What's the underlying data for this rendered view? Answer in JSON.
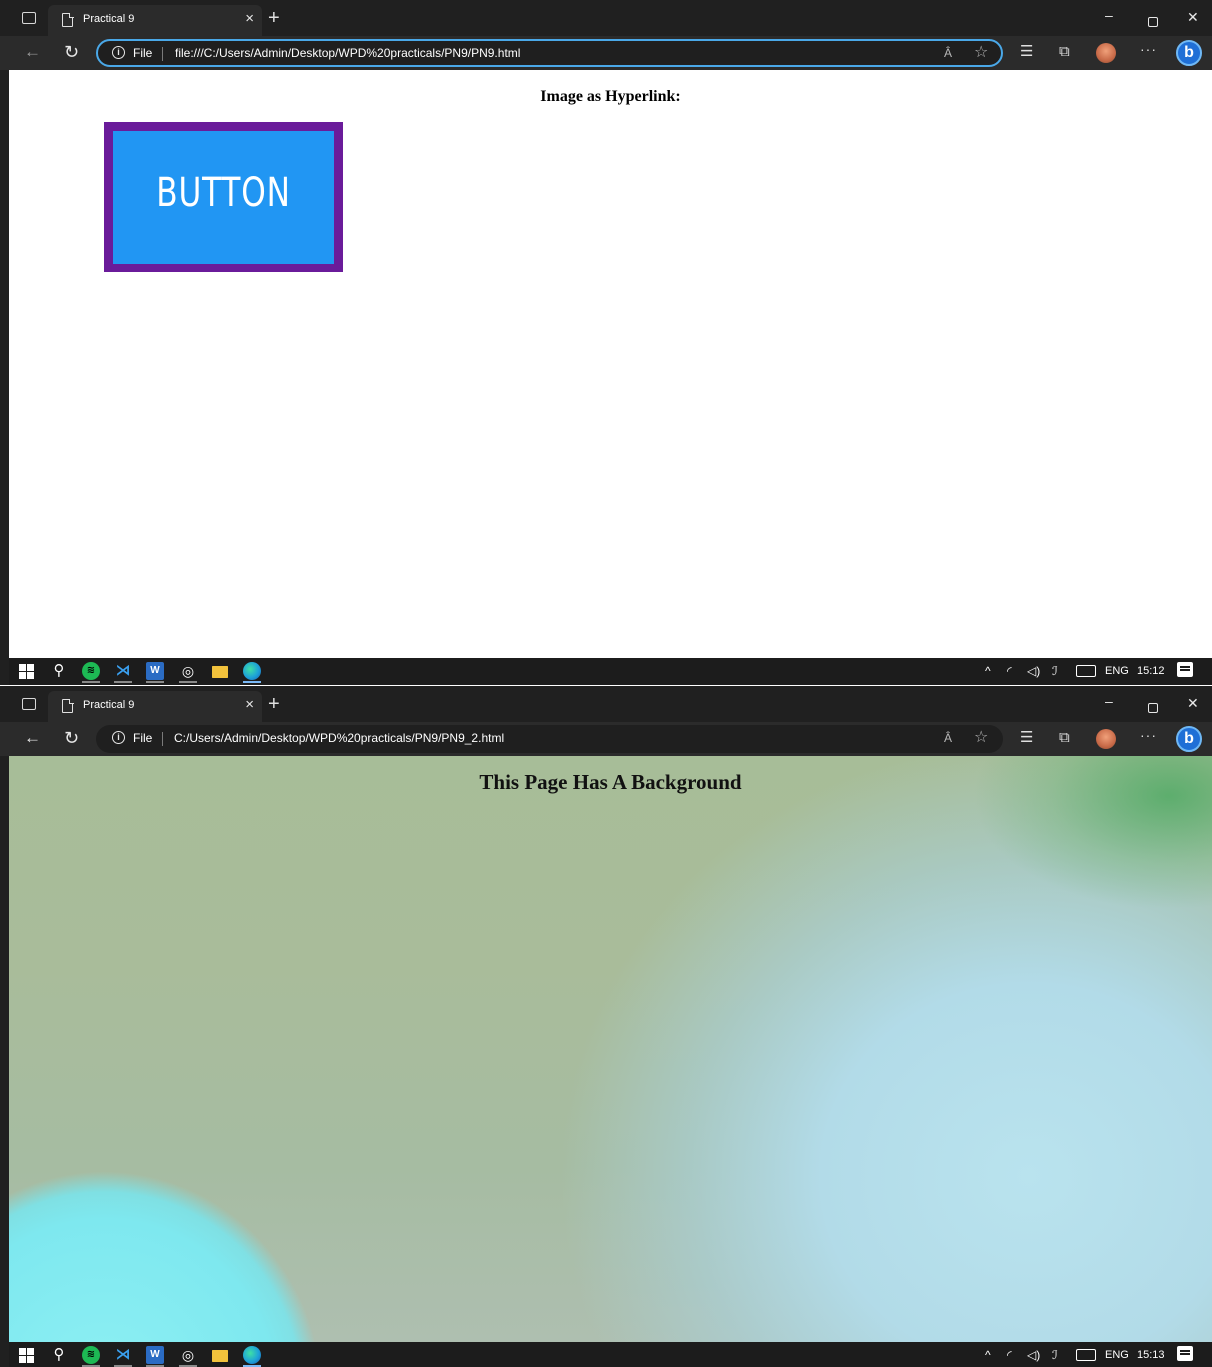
{
  "windows": [
    {
      "tab_title": "Practical 9",
      "tab_close": "×",
      "new_tab": "+",
      "file_label": "File",
      "url": "file:///C:/Users/Admin/Desktop/WPD%20practicals/PN9/PN9.html",
      "read_aloud": "Â",
      "page_heading": "Image as Hyperlink:",
      "image_link_text": "BUTTON",
      "clock": "15:12"
    },
    {
      "tab_title": "Practical 9",
      "tab_close": "×",
      "new_tab": "+",
      "file_label": "File",
      "url": "C:/Users/Admin/Desktop/WPD%20practicals/PN9/PN9_2.html",
      "read_aloud": "Â",
      "page_heading": "This Page Has A Background",
      "clock": "15:13"
    }
  ],
  "taskbar": {
    "language": "ENG"
  },
  "colors": {
    "image_border": "#6a1b9a",
    "image_face": "#2196f3",
    "address_focus": "#4aa8e8"
  },
  "icons": [
    "tab-actions-icon",
    "page-icon",
    "back-icon",
    "reload-icon",
    "info-icon",
    "read-aloud-icon",
    "favorite-star-icon",
    "favorites-icon",
    "collections-icon",
    "profile-avatar",
    "more-icon",
    "bing-icon",
    "windows-start-icon",
    "search-icon",
    "spotify-icon",
    "vscode-icon",
    "word-icon",
    "app-icon",
    "file-explorer-icon",
    "edge-icon",
    "chevron-up-icon",
    "wifi-icon",
    "volume-icon",
    "pen-icon",
    "keyboard-icon",
    "notification-icon"
  ]
}
